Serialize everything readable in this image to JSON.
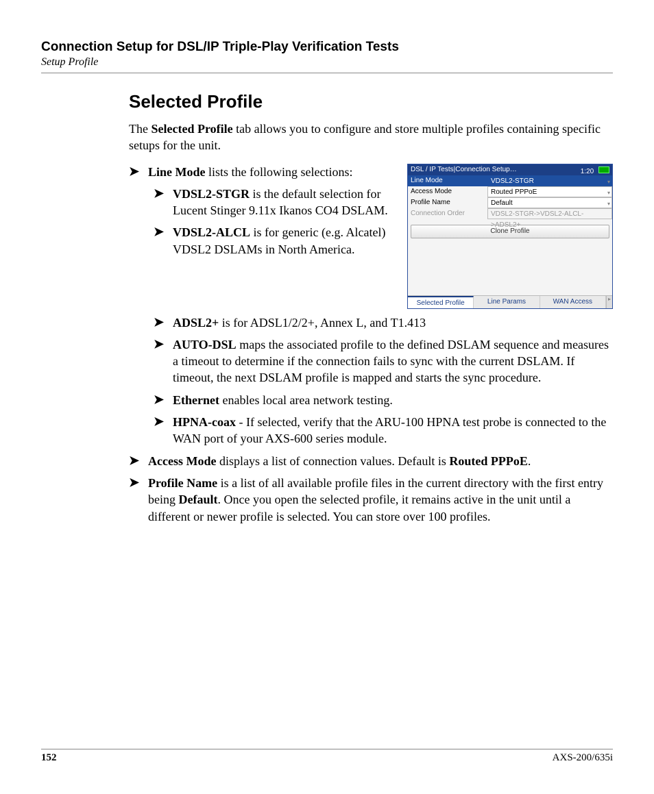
{
  "header": {
    "chapter_title": "Connection Setup for DSL/IP Triple-Play Verification Tests",
    "chapter_sub": "Setup Profile"
  },
  "section": {
    "title": "Selected Profile",
    "intro_prefix": "The ",
    "intro_bold": "Selected Profile",
    "intro_suffix": " tab allows you to configure and store multiple profiles containing specific setups for the unit."
  },
  "bullets": {
    "line_mode": {
      "term": "Line Mode",
      "rest": " lists the following selections:"
    },
    "vdsl2_stgr": {
      "term": "VDSL2-STGR",
      "rest": " is the default selection for Lucent Stinger 9.11x Ikanos CO4 DSLAM."
    },
    "vdsl2_alcl": {
      "term": "VDSL2-ALCL",
      "rest": " is for generic (e.g. Alcatel) VDSL2 DSLAMs in North America."
    },
    "adsl2p": {
      "term": "ADSL2+",
      "rest": " is for ADSL1/2/2+, Annex L, and T1.413"
    },
    "auto_dsl": {
      "term": "AUTO-DSL",
      "rest": " maps the associated profile to the defined DSLAM sequence and measures a timeout to determine if the connection fails to sync with the current DSLAM. If timeout, the next DSLAM profile is mapped and starts the sync procedure."
    },
    "ethernet": {
      "term": "Ethernet",
      "rest": " enables local area network testing."
    },
    "hpna": {
      "term": "HPNA-coax",
      "rest": " - If selected, verify that the ARU-100 HPNA test probe is connected to the WAN port of your AXS-600 series module."
    },
    "access_mode": {
      "term": "Access Mode",
      "mid": " displays a list of connection values. Default is ",
      "bold2": "Routed PPPoE",
      "end": "."
    },
    "profile_name": {
      "term": "Profile Name",
      "mid": " is a list of all available profile files in the current directory with the first entry being ",
      "bold2": "Default",
      "end": ". Once you open the selected profile, it remains active in the unit until a different or newer profile is selected. You can store over 100 profiles."
    }
  },
  "screenshot": {
    "title": "DSL / IP Tests|Connection Setup…",
    "time": "1:20",
    "rows": {
      "line_mode": {
        "label": "Line Mode",
        "value": "VDSL2-STGR"
      },
      "access_mode": {
        "label": "Access Mode",
        "value": "Routed PPPoE"
      },
      "profile_name": {
        "label": "Profile Name",
        "value": "Default"
      },
      "conn_order": {
        "label": "Connection Order",
        "value": "VDSL2-STGR->VDSL2-ALCL->ADSL2+"
      }
    },
    "clone_button": "Clone Profile",
    "tabs": {
      "selected": "Selected Profile",
      "line_params": "Line Params",
      "wan": "WAN Access"
    }
  },
  "footer": {
    "page_number": "152",
    "model": "AXS-200/635i"
  }
}
